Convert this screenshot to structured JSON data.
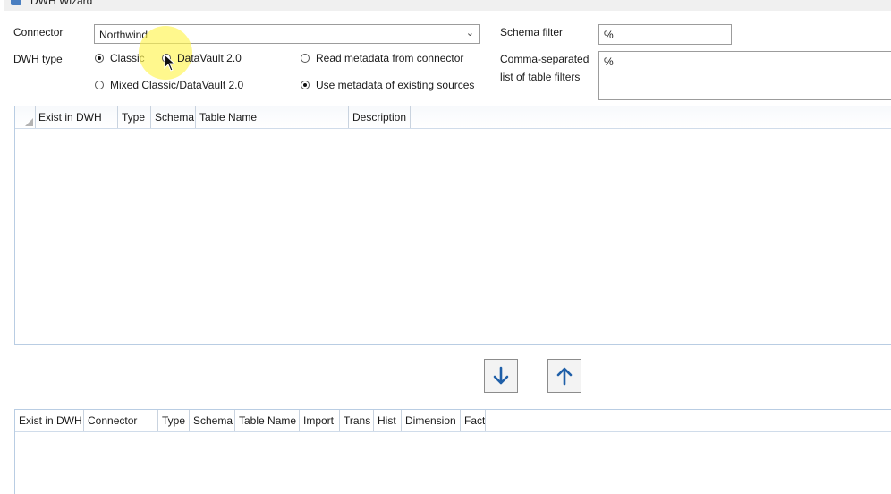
{
  "window": {
    "title": "DWH Wizard"
  },
  "form": {
    "connector_label": "Connector",
    "connector_value": "Northwind",
    "dwh_type_label": "DWH type",
    "dwh_type_options": [
      "Classic",
      "DataVault 2.0",
      "Mixed Classic/DataVault 2.0"
    ],
    "dwh_type_selected": "Classic",
    "metadata_options": [
      "Read metadata from connector",
      "Use metadata of existing sources"
    ],
    "metadata_selected": "Use metadata of existing sources",
    "schema_filter_label": "Schema filter",
    "schema_filter_value": "%",
    "table_filters_label_line1": "Comma-separated",
    "table_filters_label_line2": "list of table filters",
    "table_filters_value": "%"
  },
  "source_grid": {
    "columns": [
      "Exist in DWH",
      "Type",
      "Schema",
      "Table Name",
      "Description"
    ],
    "rows": []
  },
  "target_grid": {
    "columns": [
      "Exist in DWH",
      "Connector",
      "Type",
      "Schema",
      "Table Name",
      "Import",
      "Trans",
      "Hist",
      "Dimension",
      "Fact"
    ],
    "rows": []
  },
  "transfer_buttons": [
    {
      "icon": "arrow-down-icon",
      "action": "add selected tables"
    },
    {
      "icon": "arrow-up-icon",
      "action": "remove selected tables"
    }
  ],
  "colors": {
    "accent": "#1f5fa8",
    "grid_border": "#b9cde3",
    "highlight": "#fff550"
  }
}
